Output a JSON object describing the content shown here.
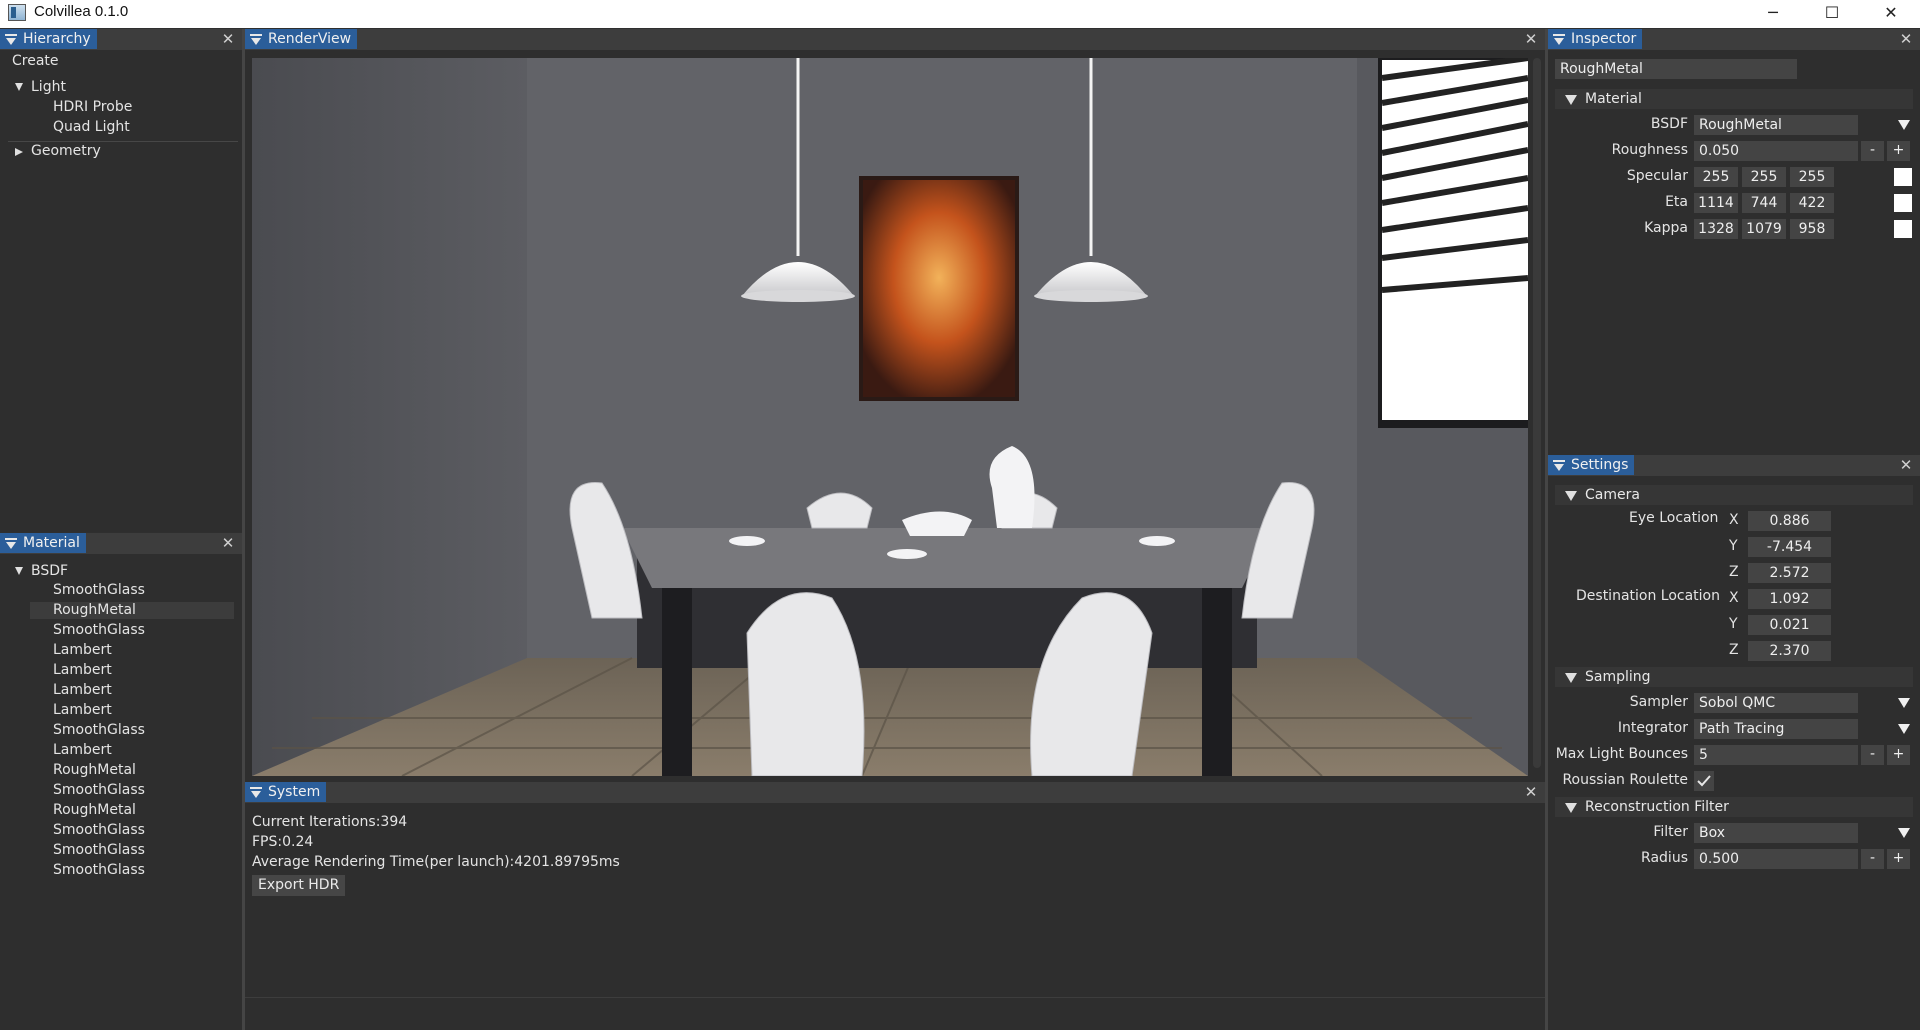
{
  "window": {
    "title": "Colvillea 0.1.0",
    "min": "─",
    "max": "☐",
    "close": "✕"
  },
  "hierarchy": {
    "tab": "Hierarchy",
    "create_label": "Create",
    "light": {
      "label": "Light",
      "children": [
        "HDRI Probe",
        "Quad Light"
      ]
    },
    "geometry": {
      "label": "Geometry"
    }
  },
  "material_panel": {
    "tab": "Material",
    "root": "BSDF",
    "items": [
      "SmoothGlass",
      "RoughMetal",
      "SmoothGlass",
      "Lambert",
      "Lambert",
      "Lambert",
      "Lambert",
      "SmoothGlass",
      "Lambert",
      "RoughMetal",
      "SmoothGlass",
      "RoughMetal",
      "SmoothGlass",
      "SmoothGlass",
      "SmoothGlass"
    ],
    "selected_index": 1
  },
  "renderview": {
    "tab": "RenderView"
  },
  "system": {
    "tab": "System",
    "iterations": "Current Iterations:394",
    "fps": "FPS:0.24",
    "avg_time": "Average Rendering Time(per launch):4201.89795ms",
    "export_label": "Export HDR"
  },
  "inspector": {
    "tab": "Inspector",
    "name_value": "RoughMetal",
    "material_header": "Material",
    "bsdf_label": "BSDF",
    "bsdf_value": "RoughMetal",
    "roughness_label": "Roughness",
    "roughness_value": "0.050",
    "specular_label": "Specular",
    "specular": [
      "255",
      "255",
      "255"
    ],
    "eta_label": "Eta",
    "eta": [
      "1114",
      "744",
      "422"
    ],
    "kappa_label": "Kappa",
    "kappa": [
      "1328",
      "1079",
      "958"
    ],
    "minus": "-",
    "plus": "+"
  },
  "settings": {
    "tab": "Settings",
    "camera_header": "Camera",
    "eye_label": "Eye Location",
    "eye": {
      "x": "0.886",
      "y": "-7.454",
      "z": "2.572"
    },
    "dest_label": "Destination Location",
    "dest": {
      "x": "1.092",
      "y": "0.021",
      "z": "2.370"
    },
    "axis": {
      "x": "X",
      "y": "Y",
      "z": "Z"
    },
    "sampling_header": "Sampling",
    "sampler_label": "Sampler",
    "sampler_value": "Sobol QMC",
    "integrator_label": "Integrator",
    "integrator_value": "Path Tracing",
    "bounces_label": "Max Light Bounces",
    "bounces_value": "5",
    "roulette_label": "Roussian Roulette",
    "roulette_checked": true,
    "recon_header": "Reconstruction Filter",
    "filter_label": "Filter",
    "filter_value": "Box",
    "radius_label": "Radius",
    "radius_value": "0.500"
  },
  "colors": {
    "tab_active": "#2b5e9a",
    "panel_bg": "#2e2e2e",
    "field_bg": "#444444",
    "selected_row": "#3c3c3c"
  }
}
